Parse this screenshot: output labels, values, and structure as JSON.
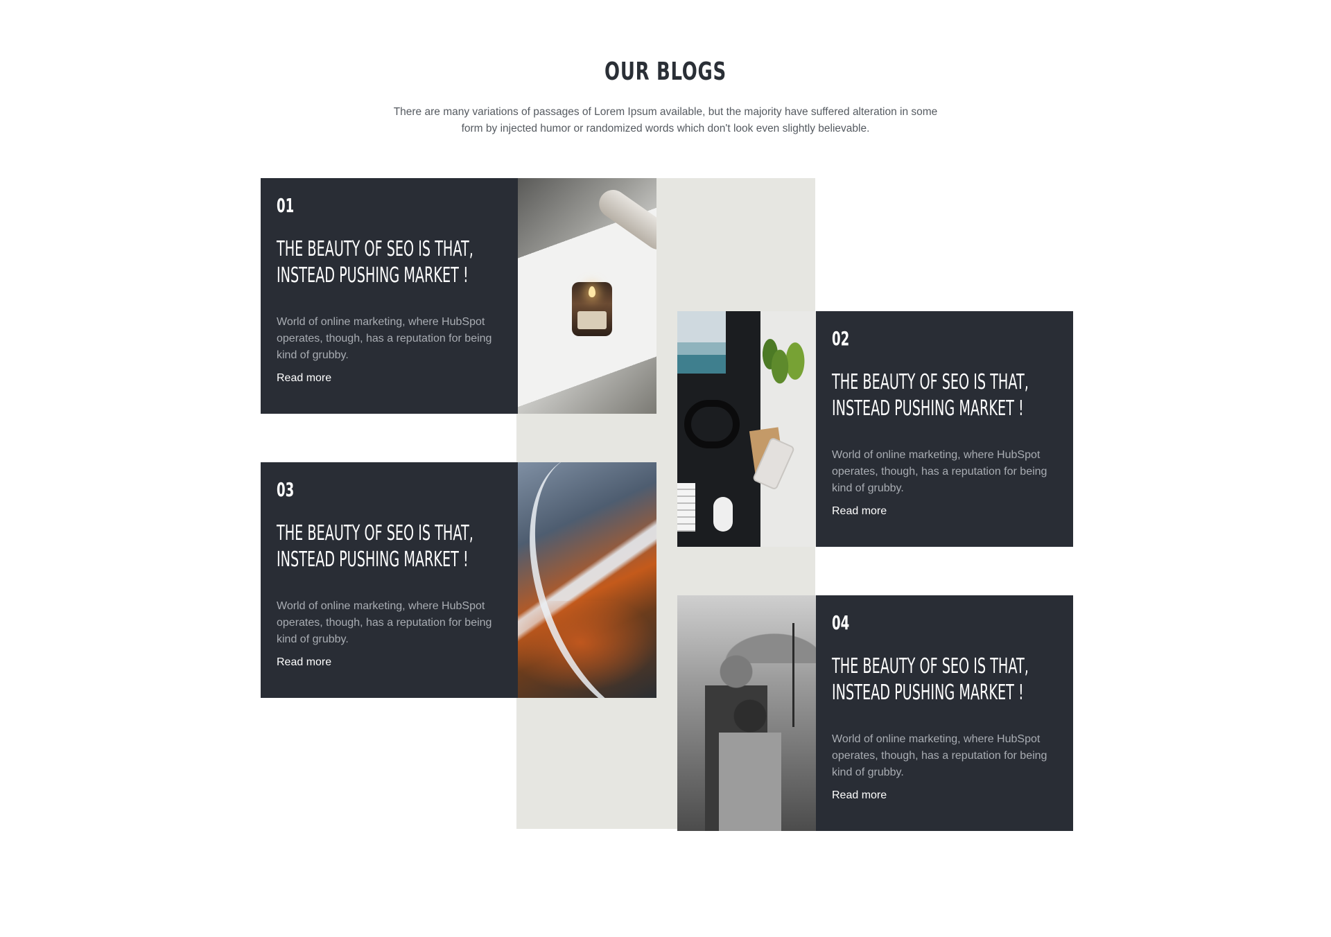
{
  "section": {
    "title": "OUR BLOGS",
    "subtitle_line1": "There are many variations of passages of Lorem Ipsum available, but the majority have suffered alteration in some",
    "subtitle_line2": "form by injected humor or randomized words which don't look even slightly believable."
  },
  "posts": [
    {
      "number": "01",
      "title_line1": "THE BEAUTY OF SEO IS THAT,",
      "title_line2": "INSTEAD PUSHING MARKET !",
      "excerpt": "World of online marketing, where HubSpot operates, though, has a reputation for being kind of grubby.",
      "read_more": "Read more",
      "image": "candle-photo"
    },
    {
      "number": "02",
      "title_line1": "THE BEAUTY OF SEO IS THAT,",
      "title_line2": "INSTEAD PUSHING MARKET !",
      "excerpt": "World of online marketing, where HubSpot operates, though, has a reputation for being kind of grubby.",
      "read_more": "Read more",
      "image": "desk-photo"
    },
    {
      "number": "03",
      "title_line1": "THE BEAUTY OF SEO IS THAT,",
      "title_line2": "INSTEAD PUSHING MARKET !",
      "excerpt": "World of online marketing, where HubSpot operates, though, has a reputation for being kind of grubby.",
      "read_more": "Read more",
      "image": "aerial-river-photo"
    },
    {
      "number": "04",
      "title_line1": "THE BEAUTY OF SEO IS THAT,",
      "title_line2": "INSTEAD PUSHING MARKET !",
      "excerpt": "World of online marketing, where HubSpot operates, though, has a reputation for being kind of grubby.",
      "read_more": "Read more",
      "image": "umbrella-couple-photo"
    }
  ],
  "colors": {
    "card_bg": "#292d35",
    "band_bg": "#e6e6e1",
    "title": "#2a2f36",
    "excerpt": "#a9adb3"
  }
}
